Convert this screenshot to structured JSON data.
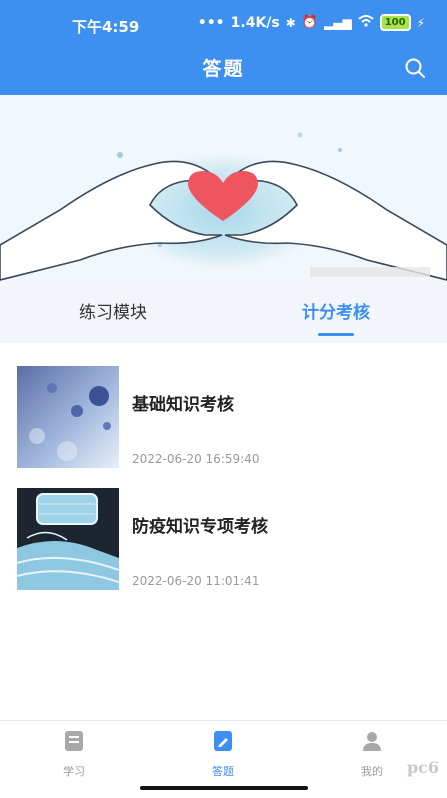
{
  "status": {
    "time": "下午4:59",
    "network_speed": "1.4K/s",
    "battery": "100"
  },
  "header": {
    "title": "答题"
  },
  "tabs": [
    {
      "label": "练习模块",
      "active": false
    },
    {
      "label": "计分考核",
      "active": true
    }
  ],
  "exams": [
    {
      "title": "基础知识考核",
      "date": "2022-06-20 16:59:40",
      "image": "virus-image"
    },
    {
      "title": "防疫知识专项考核",
      "date": "2022-06-20 11:01:41",
      "image": "face-masks-image"
    }
  ],
  "bottom_nav": [
    {
      "label": "学习",
      "icon": "book-icon",
      "active": false
    },
    {
      "label": "答题",
      "icon": "edit-note-icon",
      "active": true
    },
    {
      "label": "我的",
      "icon": "person-icon",
      "active": false
    }
  ],
  "watermark": "pc6",
  "colors": {
    "primary": "#3d8ff0",
    "inactive": "#9a9a9a"
  }
}
